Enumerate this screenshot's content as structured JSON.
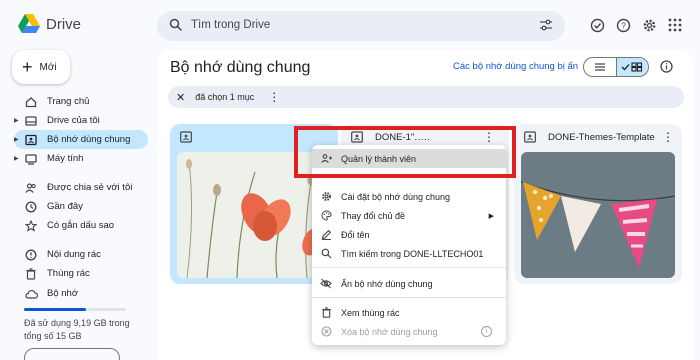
{
  "app": {
    "name": "Drive"
  },
  "search": {
    "placeholder": "Tìm trong Drive"
  },
  "top_icons": [
    "offline-status-icon",
    "help-icon",
    "settings-icon",
    "apps-grid-icon"
  ],
  "sidebar": {
    "new_label": "Mới",
    "items": [
      {
        "label": "Trang chủ",
        "icon": "home-icon",
        "expandable": false
      },
      {
        "label": "Drive của tôi",
        "icon": "my-drive-icon",
        "expandable": true
      },
      {
        "label": "Bộ nhớ dùng chung",
        "icon": "shared-drives-icon",
        "expandable": true,
        "active": true
      },
      {
        "label": "Máy tính",
        "icon": "computer-icon",
        "expandable": true
      },
      {
        "label": "Được chia sẻ với tôi",
        "icon": "shared-with-me-icon",
        "expandable": false
      },
      {
        "label": "Gần đây",
        "icon": "recent-icon",
        "expandable": false
      },
      {
        "label": "Có gắn dấu sao",
        "icon": "star-icon",
        "expandable": false
      },
      {
        "label": "Nội dung rác",
        "icon": "spam-icon",
        "expandable": false
      },
      {
        "label": "Thùng rác",
        "icon": "trash-icon",
        "expandable": false
      },
      {
        "label": "Bộ nhớ",
        "icon": "cloud-icon",
        "expandable": false
      }
    ],
    "storage": {
      "text": "Đã sử dụng 9,19 GB trong tổng số 15 GB",
      "used_fraction": 0.61
    }
  },
  "main": {
    "title": "Bộ nhớ dùng chung",
    "create_link": "Các bộ nhớ dùng chung bị ẩn",
    "selection": {
      "text": "đã chọn 1 mục"
    },
    "cards": [
      {
        "name": "",
        "selected": true
      },
      {
        "name": "DONE-1\"․․․․․",
        "selected": false
      },
      {
        "name": "DONE-Themes-Template",
        "selected": false
      }
    ]
  },
  "context_menu": {
    "items": [
      {
        "label": "Quản lý thành viên",
        "icon": "manage-members-icon",
        "highlighted": true
      },
      {
        "label": "Cài đặt bộ nhớ dùng chung",
        "icon": "settings-icon"
      },
      {
        "label": "Thay đổi chủ đề",
        "icon": "palette-icon",
        "submenu": true
      },
      {
        "label": "Đổi tên",
        "icon": "rename-icon"
      },
      {
        "label": "Tìm kiếm trong DONE-LLTECHO01",
        "icon": "search-icon"
      },
      {
        "label": "Ẩn bộ nhớ dùng chung",
        "icon": "hide-icon"
      },
      {
        "label": "Xem thùng rác",
        "icon": "trash-icon"
      },
      {
        "label": "Xóa bộ nhớ dùng chung",
        "icon": "delete-icon",
        "disabled": true
      }
    ]
  },
  "colors": {
    "accent": "#0b57d0",
    "selected_bg": "#c2e7ff",
    "highlight_box": "#e02020"
  }
}
